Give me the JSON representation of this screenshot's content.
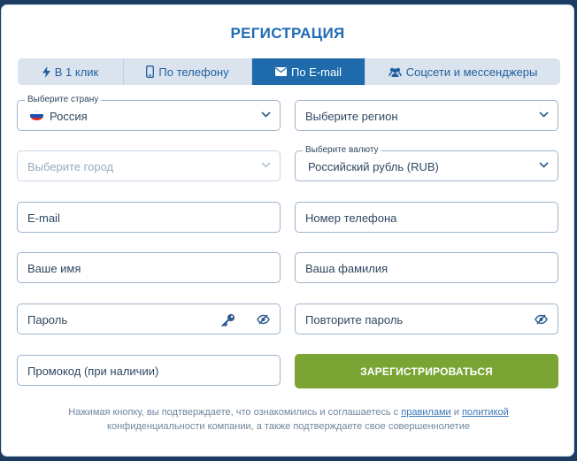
{
  "title": "РЕГИСТРАЦИЯ",
  "tabs": [
    {
      "label": "В 1 клик",
      "icon": "lightning-icon"
    },
    {
      "label": "По телефону",
      "icon": "phone-icon"
    },
    {
      "label": "По E-mail",
      "icon": "envelope-icon",
      "active": true
    },
    {
      "label": "Соцсети и мессенджеры",
      "icon": "users-icon"
    }
  ],
  "form": {
    "country": {
      "legend": "Выберите страну",
      "value": "Россия"
    },
    "region": {
      "value": "Выберите регион"
    },
    "city": {
      "value": "Выберите город"
    },
    "currency": {
      "legend": "Выберите валюту",
      "value": "Российский рубль (RUB)"
    },
    "email": {
      "placeholder": "E-mail"
    },
    "phone": {
      "placeholder": "Номер телефона"
    },
    "first_name": {
      "placeholder": "Ваше имя"
    },
    "last_name": {
      "placeholder": "Ваша фамилия"
    },
    "password": {
      "placeholder": "Пароль"
    },
    "password_repeat": {
      "placeholder": "Повторите пароль"
    },
    "promo": {
      "placeholder": "Промокод (при наличии)"
    }
  },
  "register_button": "ЗАРЕГИСТРИРОВАТЬСЯ",
  "terms": {
    "prefix": "Нажимая кнопку, вы подтверждаете, что ознакомились и соглашаетесь с ",
    "rules_link": "правилами",
    "and": " и ",
    "policy_link": "политикой",
    "suffix": " конфиденциальности компании, а также подтверждаете свое совершеннолетие"
  },
  "colors": {
    "accent": "#1e6aaa",
    "title": "#1f6bb5",
    "register": "#7aa534",
    "background": "#1b3b63"
  }
}
